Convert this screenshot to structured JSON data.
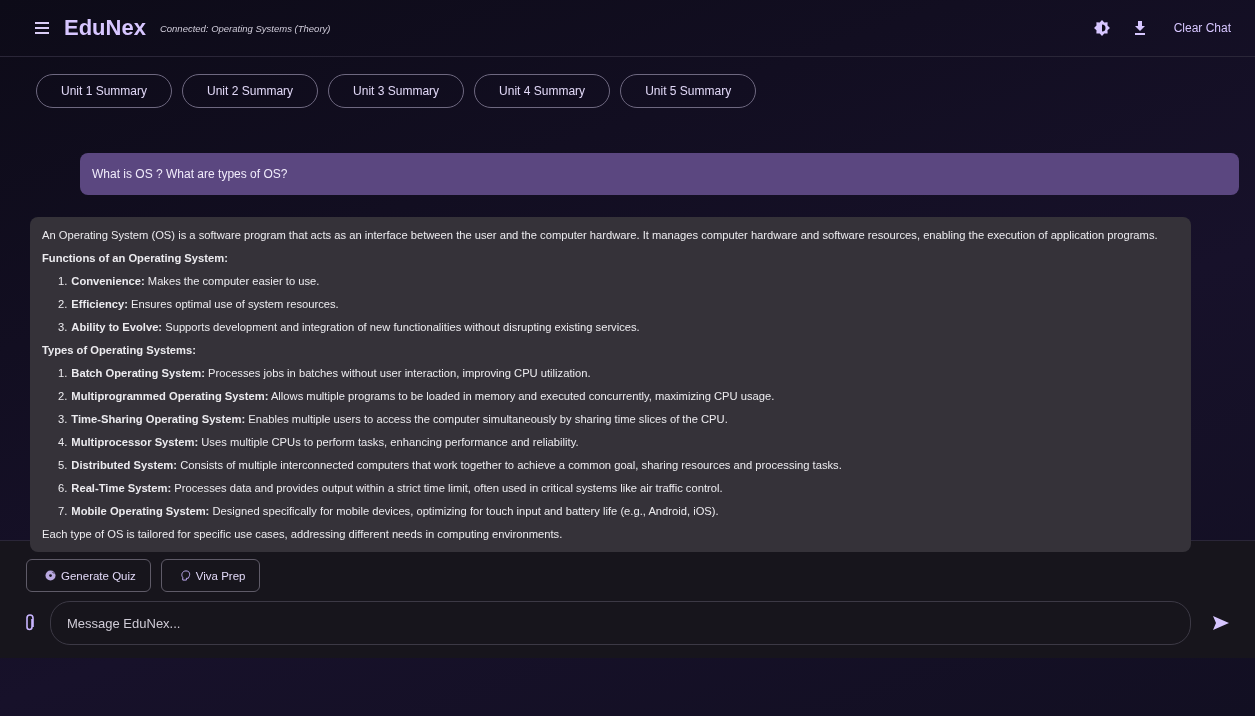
{
  "header": {
    "title": "EduNex",
    "status": "Connected: Operating Systems (Theory)",
    "actions": {
      "clear": "Clear Chat"
    }
  },
  "chips": [
    "Unit 1 Summary",
    "Unit 2 Summary",
    "Unit 3 Summary",
    "Unit 4 Summary",
    "Unit 5 Summary"
  ],
  "messages": [
    {
      "kind": "user",
      "text": "What is OS ? What are types of OS?"
    },
    {
      "kind": "assistant",
      "blocks": [
        {
          "kind": "para",
          "text": "An Operating System (OS) is a software program that acts as an interface between the user and the computer hardware. It manages computer hardware and software resources, enabling the execution of application programs."
        },
        {
          "kind": "heading",
          "text": "Functions of an Operating System:"
        },
        {
          "kind": "list",
          "items": [
            {
              "num": "1.",
              "text": "**Convenience:** Makes the computer easier to use."
            },
            {
              "num": "2.",
              "text": "**Efficiency:** Ensures optimal use of system resources."
            },
            {
              "num": "3.",
              "text": "**Ability to Evolve:** Supports development and integration of new functionalities without disrupting existing services."
            }
          ]
        },
        {
          "kind": "heading",
          "text": "Types of Operating Systems:"
        },
        {
          "kind": "list",
          "items": [
            {
              "num": "1.",
              "text": "**Batch Operating System:** Processes jobs in batches without user interaction, improving CPU utilization."
            },
            {
              "num": "2.",
              "text": "**Multiprogrammed Operating System:** Allows multiple programs to be loaded in memory and executed concurrently, maximizing CPU usage."
            },
            {
              "num": "3.",
              "text": "**Time-Sharing Operating System:** Enables multiple users to access the computer simultaneously by sharing time slices of the CPU."
            },
            {
              "num": "4.",
              "text": "**Multiprocessor System:** Uses multiple CPUs to perform tasks, enhancing performance and reliability."
            },
            {
              "num": "5.",
              "text": "**Distributed System:** Consists of multiple interconnected computers that work together to achieve a common goal, sharing resources and processing tasks."
            },
            {
              "num": "6.",
              "text": "**Real-Time System:** Processes data and provides output within a strict time limit, often used in critical systems like air traffic control."
            },
            {
              "num": "7.",
              "text": "**Mobile Operating System:** Designed specifically for mobile devices, optimizing for touch input and battery life (e.g., Android, iOS)."
            }
          ]
        },
        {
          "kind": "para",
          "text": "Each type of OS is tailored for specific use cases, addressing different needs in computing environments."
        }
      ]
    }
  ],
  "tools": [
    {
      "kind": "quiz",
      "label": "Generate Quiz"
    },
    {
      "kind": "viva",
      "label": "Viva Prep"
    }
  ],
  "composer": {
    "placeholder": "Message EduNex..."
  }
}
